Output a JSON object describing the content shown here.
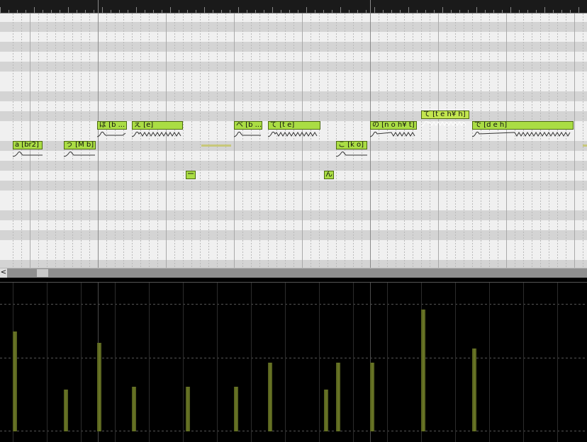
{
  "scroll_left_label": "<",
  "notes": [
    {
      "id": "a-br2",
      "label": "a [br2]"
    },
    {
      "id": "u-mb",
      "label": "う [M b]"
    },
    {
      "id": "ba",
      "label": "ば [b ..."
    },
    {
      "id": "e",
      "label": "え [e]"
    },
    {
      "id": "dash",
      "label": "ー"
    },
    {
      "id": "be",
      "label": "べ [b ..."
    },
    {
      "id": "te",
      "label": "て [t e]"
    },
    {
      "id": "n",
      "label": "ん"
    },
    {
      "id": "ko",
      "label": "こ [k o]"
    },
    {
      "id": "no",
      "label": "の [n o h¥ t]"
    },
    {
      "id": "te2",
      "label": "て [t e h¥ h]"
    },
    {
      "id": "de",
      "label": "で [d e h]"
    }
  ],
  "velocity": [
    0.71,
    0.3,
    0.63,
    0.32,
    0.32,
    0.32,
    0.49,
    0.3,
    0.49,
    0.49,
    0.87,
    0.59
  ]
}
